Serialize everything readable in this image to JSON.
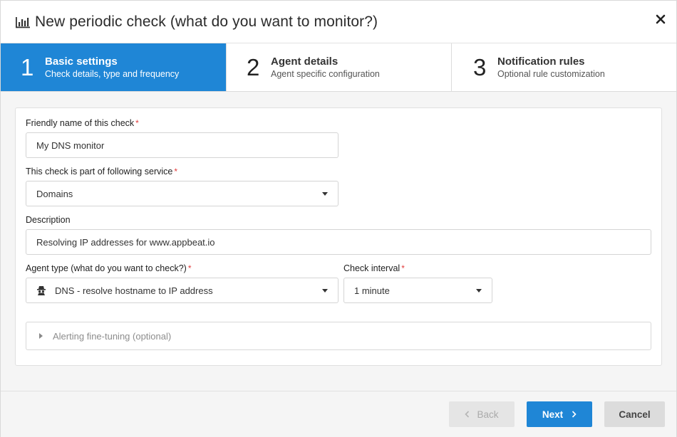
{
  "dialog": {
    "title": "New periodic check (what do you want to monitor?)",
    "icon": "bar-chart-icon",
    "close_icon": "close-icon"
  },
  "steps": [
    {
      "number": "1",
      "title": "Basic settings",
      "subtitle": "Check details, type and frequency",
      "active": true
    },
    {
      "number": "2",
      "title": "Agent details",
      "subtitle": "Agent specific configuration",
      "active": false
    },
    {
      "number": "3",
      "title": "Notification rules",
      "subtitle": "Optional rule customization",
      "active": false
    }
  ],
  "form": {
    "friendly_name": {
      "label": "Friendly name of this check",
      "required_mark": "*",
      "value": "My DNS monitor"
    },
    "service": {
      "label": "This check is part of following service",
      "required_mark": "*",
      "value": "Domains"
    },
    "description": {
      "label": "Description",
      "value": "Resolving IP addresses for www.appbeat.io"
    },
    "agent_type": {
      "label": "Agent type (what do you want to check?)",
      "required_mark": "*",
      "value": "DNS - resolve hostname to IP address",
      "icon": "spy-icon"
    },
    "check_interval": {
      "label": "Check interval",
      "required_mark": "*",
      "value": "1 minute"
    },
    "alerting": {
      "label": "Alerting fine-tuning (optional)"
    }
  },
  "footer": {
    "back_label": "Back",
    "next_label": "Next",
    "cancel_label": "Cancel"
  },
  "colors": {
    "accent": "#1f86d6",
    "required": "#e23b3b"
  }
}
